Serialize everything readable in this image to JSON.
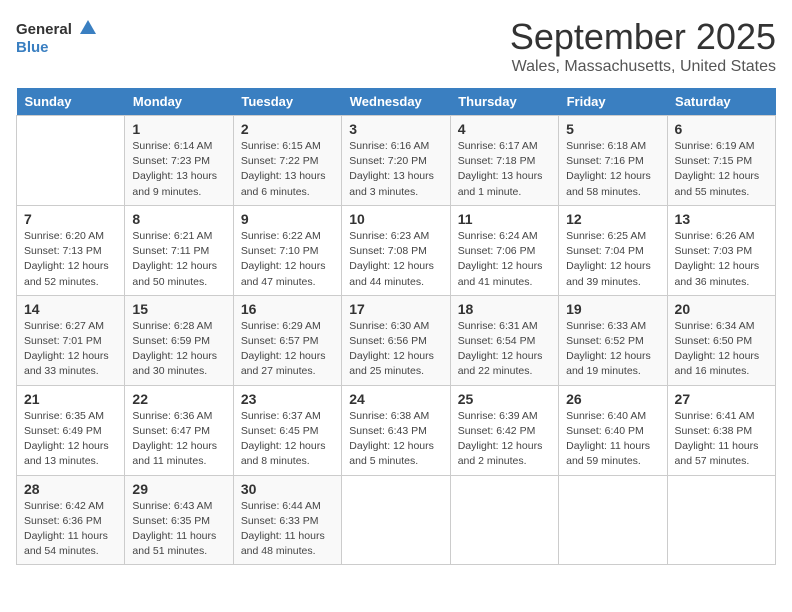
{
  "logo": {
    "general": "General",
    "blue": "Blue"
  },
  "title": "September 2025",
  "location": "Wales, Massachusetts, United States",
  "days_of_week": [
    "Sunday",
    "Monday",
    "Tuesday",
    "Wednesday",
    "Thursday",
    "Friday",
    "Saturday"
  ],
  "weeks": [
    [
      {
        "day": "",
        "sunrise": "",
        "sunset": "",
        "daylight": ""
      },
      {
        "day": "1",
        "sunrise": "Sunrise: 6:14 AM",
        "sunset": "Sunset: 7:23 PM",
        "daylight": "Daylight: 13 hours and 9 minutes."
      },
      {
        "day": "2",
        "sunrise": "Sunrise: 6:15 AM",
        "sunset": "Sunset: 7:22 PM",
        "daylight": "Daylight: 13 hours and 6 minutes."
      },
      {
        "day": "3",
        "sunrise": "Sunrise: 6:16 AM",
        "sunset": "Sunset: 7:20 PM",
        "daylight": "Daylight: 13 hours and 3 minutes."
      },
      {
        "day": "4",
        "sunrise": "Sunrise: 6:17 AM",
        "sunset": "Sunset: 7:18 PM",
        "daylight": "Daylight: 13 hours and 1 minute."
      },
      {
        "day": "5",
        "sunrise": "Sunrise: 6:18 AM",
        "sunset": "Sunset: 7:16 PM",
        "daylight": "Daylight: 12 hours and 58 minutes."
      },
      {
        "day": "6",
        "sunrise": "Sunrise: 6:19 AM",
        "sunset": "Sunset: 7:15 PM",
        "daylight": "Daylight: 12 hours and 55 minutes."
      }
    ],
    [
      {
        "day": "7",
        "sunrise": "Sunrise: 6:20 AM",
        "sunset": "Sunset: 7:13 PM",
        "daylight": "Daylight: 12 hours and 52 minutes."
      },
      {
        "day": "8",
        "sunrise": "Sunrise: 6:21 AM",
        "sunset": "Sunset: 7:11 PM",
        "daylight": "Daylight: 12 hours and 50 minutes."
      },
      {
        "day": "9",
        "sunrise": "Sunrise: 6:22 AM",
        "sunset": "Sunset: 7:10 PM",
        "daylight": "Daylight: 12 hours and 47 minutes."
      },
      {
        "day": "10",
        "sunrise": "Sunrise: 6:23 AM",
        "sunset": "Sunset: 7:08 PM",
        "daylight": "Daylight: 12 hours and 44 minutes."
      },
      {
        "day": "11",
        "sunrise": "Sunrise: 6:24 AM",
        "sunset": "Sunset: 7:06 PM",
        "daylight": "Daylight: 12 hours and 41 minutes."
      },
      {
        "day": "12",
        "sunrise": "Sunrise: 6:25 AM",
        "sunset": "Sunset: 7:04 PM",
        "daylight": "Daylight: 12 hours and 39 minutes."
      },
      {
        "day": "13",
        "sunrise": "Sunrise: 6:26 AM",
        "sunset": "Sunset: 7:03 PM",
        "daylight": "Daylight: 12 hours and 36 minutes."
      }
    ],
    [
      {
        "day": "14",
        "sunrise": "Sunrise: 6:27 AM",
        "sunset": "Sunset: 7:01 PM",
        "daylight": "Daylight: 12 hours and 33 minutes."
      },
      {
        "day": "15",
        "sunrise": "Sunrise: 6:28 AM",
        "sunset": "Sunset: 6:59 PM",
        "daylight": "Daylight: 12 hours and 30 minutes."
      },
      {
        "day": "16",
        "sunrise": "Sunrise: 6:29 AM",
        "sunset": "Sunset: 6:57 PM",
        "daylight": "Daylight: 12 hours and 27 minutes."
      },
      {
        "day": "17",
        "sunrise": "Sunrise: 6:30 AM",
        "sunset": "Sunset: 6:56 PM",
        "daylight": "Daylight: 12 hours and 25 minutes."
      },
      {
        "day": "18",
        "sunrise": "Sunrise: 6:31 AM",
        "sunset": "Sunset: 6:54 PM",
        "daylight": "Daylight: 12 hours and 22 minutes."
      },
      {
        "day": "19",
        "sunrise": "Sunrise: 6:33 AM",
        "sunset": "Sunset: 6:52 PM",
        "daylight": "Daylight: 12 hours and 19 minutes."
      },
      {
        "day": "20",
        "sunrise": "Sunrise: 6:34 AM",
        "sunset": "Sunset: 6:50 PM",
        "daylight": "Daylight: 12 hours and 16 minutes."
      }
    ],
    [
      {
        "day": "21",
        "sunrise": "Sunrise: 6:35 AM",
        "sunset": "Sunset: 6:49 PM",
        "daylight": "Daylight: 12 hours and 13 minutes."
      },
      {
        "day": "22",
        "sunrise": "Sunrise: 6:36 AM",
        "sunset": "Sunset: 6:47 PM",
        "daylight": "Daylight: 12 hours and 11 minutes."
      },
      {
        "day": "23",
        "sunrise": "Sunrise: 6:37 AM",
        "sunset": "Sunset: 6:45 PM",
        "daylight": "Daylight: 12 hours and 8 minutes."
      },
      {
        "day": "24",
        "sunrise": "Sunrise: 6:38 AM",
        "sunset": "Sunset: 6:43 PM",
        "daylight": "Daylight: 12 hours and 5 minutes."
      },
      {
        "day": "25",
        "sunrise": "Sunrise: 6:39 AM",
        "sunset": "Sunset: 6:42 PM",
        "daylight": "Daylight: 12 hours and 2 minutes."
      },
      {
        "day": "26",
        "sunrise": "Sunrise: 6:40 AM",
        "sunset": "Sunset: 6:40 PM",
        "daylight": "Daylight: 11 hours and 59 minutes."
      },
      {
        "day": "27",
        "sunrise": "Sunrise: 6:41 AM",
        "sunset": "Sunset: 6:38 PM",
        "daylight": "Daylight: 11 hours and 57 minutes."
      }
    ],
    [
      {
        "day": "28",
        "sunrise": "Sunrise: 6:42 AM",
        "sunset": "Sunset: 6:36 PM",
        "daylight": "Daylight: 11 hours and 54 minutes."
      },
      {
        "day": "29",
        "sunrise": "Sunrise: 6:43 AM",
        "sunset": "Sunset: 6:35 PM",
        "daylight": "Daylight: 11 hours and 51 minutes."
      },
      {
        "day": "30",
        "sunrise": "Sunrise: 6:44 AM",
        "sunset": "Sunset: 6:33 PM",
        "daylight": "Daylight: 11 hours and 48 minutes."
      },
      {
        "day": "",
        "sunrise": "",
        "sunset": "",
        "daylight": ""
      },
      {
        "day": "",
        "sunrise": "",
        "sunset": "",
        "daylight": ""
      },
      {
        "day": "",
        "sunrise": "",
        "sunset": "",
        "daylight": ""
      },
      {
        "day": "",
        "sunrise": "",
        "sunset": "",
        "daylight": ""
      }
    ]
  ]
}
